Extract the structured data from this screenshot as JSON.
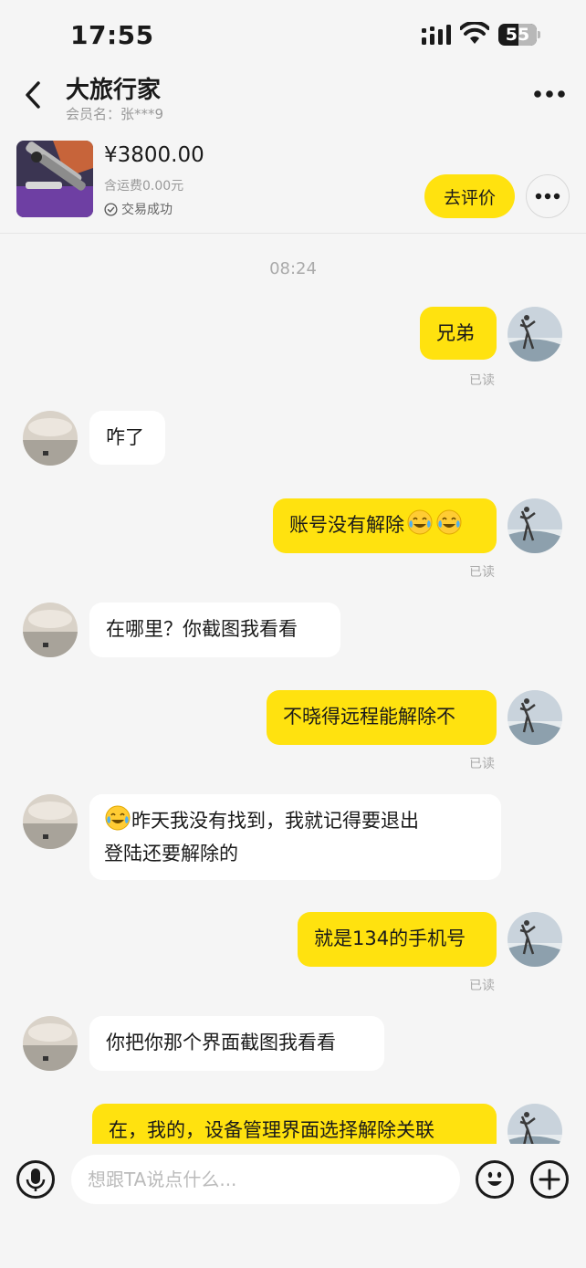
{
  "status_bar": {
    "time": "17:55",
    "battery": "55"
  },
  "header": {
    "title": "大旅行家",
    "subtitle": "会员名：张***9"
  },
  "product": {
    "price": "¥3800.00",
    "shipping": "含运费0.00元",
    "status": "交易成功",
    "review_label": "去评价"
  },
  "chat": {
    "timestamp": "08:24",
    "read_label": "已读",
    "messages": [
      {
        "from": "me",
        "text": "兄弟"
      },
      {
        "from": "other",
        "text": "咋了"
      },
      {
        "from": "me",
        "text": "账号没有解除"
      },
      {
        "from": "other",
        "text": "在哪里？你截图我看看"
      },
      {
        "from": "me",
        "text": "不晓得远程能解除不"
      },
      {
        "from": "other",
        "text": "昨天我没有找到，我就记得要退出\n登陆还要解除的"
      },
      {
        "from": "me",
        "text": "就是134的手机号"
      },
      {
        "from": "other",
        "text": "你把你那个界面截图我看看"
      },
      {
        "from": "me",
        "text": "在，我的，设备管理界面选择解除关联"
      }
    ]
  },
  "input_bar": {
    "placeholder": "想跟TA说点什么..."
  },
  "colors": {
    "accent": "#ffe20f",
    "background": "#f5f5f5",
    "bubble_other": "#ffffff"
  },
  "icons": [
    "back-icon",
    "more-icon",
    "check-icon",
    "mic-icon",
    "emoji-icon",
    "plus-icon",
    "laugh-cry-emoji"
  ]
}
